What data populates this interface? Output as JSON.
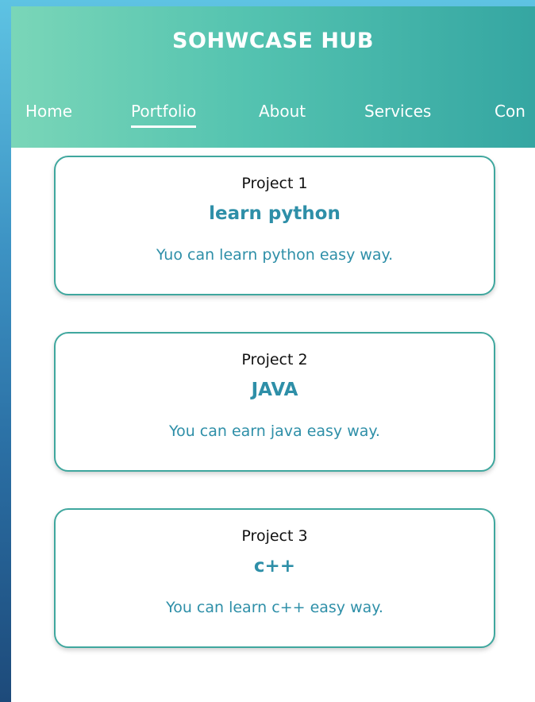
{
  "header": {
    "title": "SOHWCASE HUB",
    "nav": [
      {
        "label": "Home",
        "active": false
      },
      {
        "label": "Portfolio",
        "active": true
      },
      {
        "label": "About",
        "active": false
      },
      {
        "label": "Services",
        "active": false
      },
      {
        "label": "Con",
        "active": false
      }
    ]
  },
  "projects": [
    {
      "label": "Project 1",
      "title": "learn python",
      "description": "Yuo can learn python easy way."
    },
    {
      "label": "Project 2",
      "title": "JAVA",
      "description": "You can earn java easy way."
    },
    {
      "label": "Project 3",
      "title": "c++",
      "description": "You can learn c++ easy way."
    }
  ],
  "colors": {
    "header_gradient_start": "#7ad6b8",
    "header_gradient_end": "#35a6a2",
    "accent": "#2e8fa8",
    "card_border": "#3fa79e"
  }
}
